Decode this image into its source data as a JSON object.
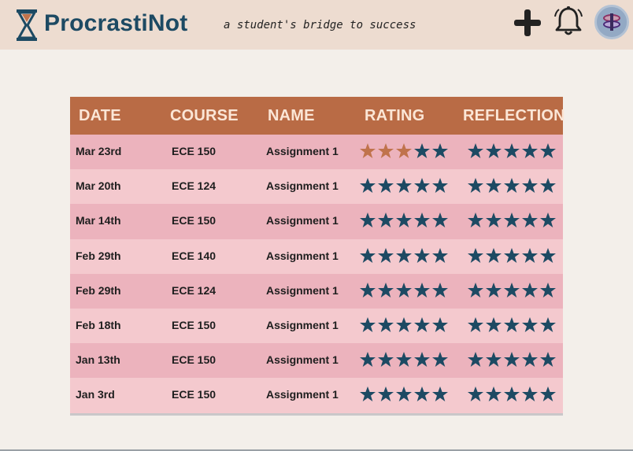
{
  "brand": {
    "name": "ProcrastiNot",
    "tagline": "a student's bridge to success"
  },
  "header": {
    "icons": [
      "hourglass-icon",
      "plus-icon",
      "bell-icon",
      "avatar"
    ]
  },
  "colors": {
    "topbar": "#eddcd0",
    "header_bg": "#b96b45",
    "header_text": "#fbe6d6",
    "row_dark": "#ecb3bd",
    "row_light": "#f4c9ce",
    "star_filled": "#c0734c",
    "star_empty": "#1d4a63",
    "brand": "#1d4a63"
  },
  "table": {
    "columns": [
      "DATE",
      "COURSE",
      "NAME",
      "RATING",
      "REFLECTION"
    ],
    "rows": [
      {
        "date": "Mar 23rd",
        "course": "ECE 150",
        "name": "Assignment 1",
        "rating": 3,
        "reflection": 0
      },
      {
        "date": "Mar 20th",
        "course": "ECE 124",
        "name": "Assignment 1",
        "rating": 0,
        "reflection": 0
      },
      {
        "date": "Mar 14th",
        "course": "ECE 150",
        "name": "Assignment 1",
        "rating": 0,
        "reflection": 0
      },
      {
        "date": "Feb 29th",
        "course": "ECE 140",
        "name": "Assignment 1",
        "rating": 0,
        "reflection": 0
      },
      {
        "date": "Feb 29th",
        "course": "ECE 124",
        "name": "Assignment 1",
        "rating": 0,
        "reflection": 0
      },
      {
        "date": "Feb 18th",
        "course": "ECE 150",
        "name": "Assignment 1",
        "rating": 0,
        "reflection": 0
      },
      {
        "date": "Jan 13th",
        "course": "ECE 150",
        "name": "Assignment 1",
        "rating": 0,
        "reflection": 0
      },
      {
        "date": "Jan 3rd",
        "course": "ECE 150",
        "name": "Assignment 1",
        "rating": 0,
        "reflection": 0
      }
    ],
    "max_stars": 5
  }
}
